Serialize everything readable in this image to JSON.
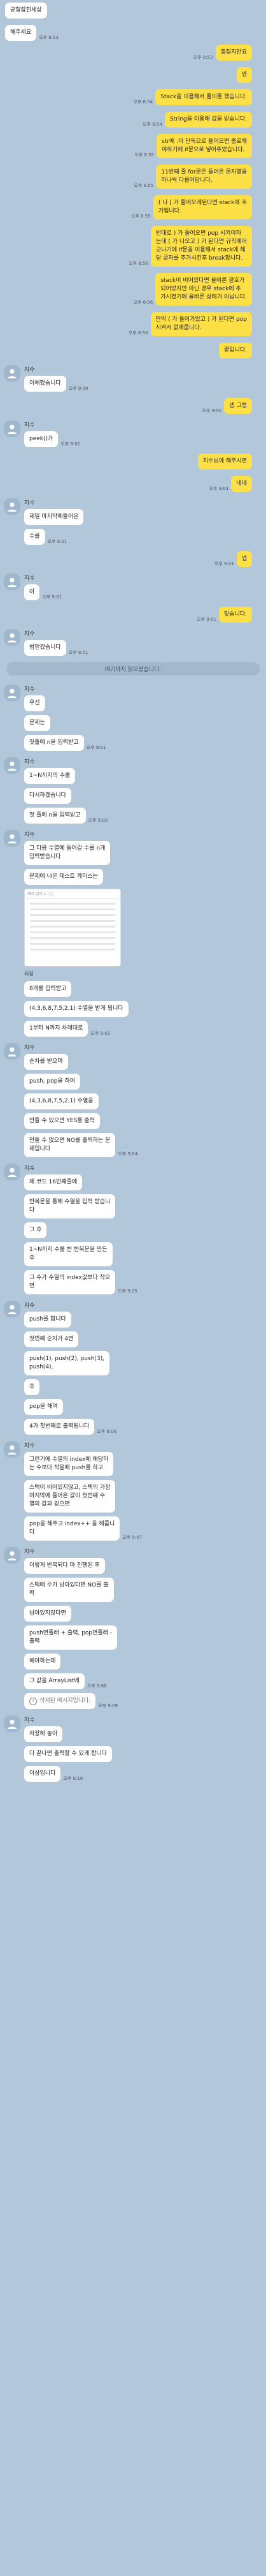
{
  "msgs": {
    "m1": "균형잡힌세상",
    "m2": "해주세요",
    "t853": "오후 8:53",
    "t854": "오후 8:54",
    "t855": "오후 8:55",
    "t856": "오후 8:56",
    "t900": "오후 9:00",
    "t901": "오후 9:01",
    "t902": "오후 9:02",
    "t903": "오후 9:03",
    "t904": "오후 9:04",
    "t905": "오후 9:05",
    "t906": "오후 9:06",
    "t907": "오후 9:07",
    "t908": "오후 9:08",
    "t909": "오후 9:09",
    "t910": "오후 9:10",
    "r1": "앱잡지만요",
    "r2": "넵",
    "r3": "Stack을 이용해서 풀이를 했습니다.",
    "r4": "String을 이용해 값을 받습니다.",
    "r5": "str에 .이 단독으로 들어오면 종료해\n야하기에 if문으로 넣어주었습니다.",
    "r6": "11번째 줄 for문은 들어온 문자열을\n하나씩 다룹어답니다.",
    "r7": "( 나 [ 가 들어오게된다면 stack에 추\n가됩니다.",
    "r8": "반대로 ) 가 들어오면 pop 시켜야하\n는데 ( 가 나오고 ) 가 된다면 규칙에어\n긋나기에 if문을 이용해서 stack에 해\n당 글자를 추가시킨후 break합니다.",
    "r9": "stack이 비어있다면 올바른 괄호가\n되어었지만 아닌 경우 stack에 추\n가시켰기에 올바른 상태가 아닙니다.",
    "r10": "만약 ( 가 들어가있고 ) 가 된다면 pop\n시켜서 없애줍니다.",
    "r11": "끝입니다.",
    "sender": "지수",
    "l1": "이해했습니다",
    "r12": "넵 그럼",
    "l2": "peek()가",
    "r13": "지수님께 해주시면",
    "r14": "네네",
    "l3": "제일 마지막에들어온",
    "l4": "수를",
    "r15": "넵",
    "l5": "아",
    "r16": "맞습니다.",
    "l6": "법얻겠습니다",
    "notice": "여기까지 읽으셨습니다.",
    "g1": [
      "우선",
      "문제는",
      "첫줄에 n을 입력받고"
    ],
    "g2": [
      "1~N까지의 수를",
      "다시하겠습니다",
      "첫 줄에 n을 입력받고"
    ],
    "g3a": "그 다음 수열에 들어갈 수를 n개\n입력받습니다",
    "g3b": "문제에 나온 테스트 케이스는",
    "shot_hd": "예제 입력 1 ○○",
    "g3c": "저징",
    "g3d": [
      "8개를 입력받고",
      "(4,3,6,8,7,5,2,1) 수열을 받게 됩니다",
      "1부터 N까지 차례대로"
    ],
    "g4": [
      "순차를 받으며",
      "push, pop을 하여",
      "(4,3,6,8,7,5,2,1) 수열을",
      "만들 수 있으면 YES를 출력",
      "만들 수 없으면 NO를 출력하는 문\n제입니다"
    ],
    "g5": [
      "제 코드 16번째줄에",
      "반복문을 통해 수열을 입력 받습니\n다",
      "그 후",
      "1~N까지 수를 반 반복문을 만든\n후",
      "그 수가 수열의 index값보다 작으\n면"
    ],
    "g6": [
      "push를 합니다",
      "첫번째 순자가 4면",
      "push(1), push(2), push(3),\npush(4),",
      "후",
      "pop을 해여",
      "4가 첫번째로 출력됩니다"
    ],
    "g7": [
      "그런기에 수열의 index에 해당하\n는 수보다 작을때 push를 하고",
      "스택이 비어있지않고, 스택의 가장\n마지막에 들어온 값이 첫번째 수\n열의 값과 같으면",
      "pop을 해주고 index++ 을 해줍니\n다"
    ],
    "g8": [
      "이렇게 반복되다 마 진행된 후",
      "스택에 수가 남아있다면 NO를 출\n력",
      "남아있지않다면",
      "push면플래 + 출력, pop면플래 -\n출력",
      "해야하는데",
      "그 값을 ArrayList에"
    ],
    "deleted": "삭제된 메시지입니다.",
    "g9": [
      "지수",
      "저장해 놓아",
      "다 끝나면 출력할 수 있게 합니다",
      "이상입니다"
    ]
  }
}
